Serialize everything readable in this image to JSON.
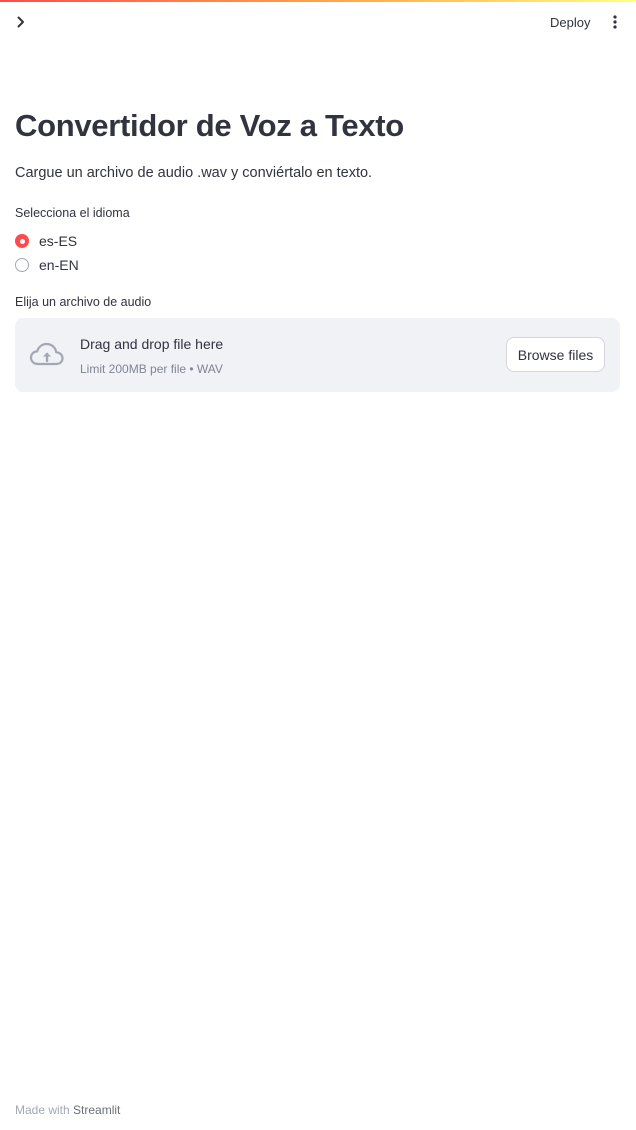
{
  "header": {
    "sidebar_toggle_icon": "chevron-right-icon",
    "deploy_label": "Deploy",
    "menu_icon": "vertical-dots-icon"
  },
  "main": {
    "title": "Convertidor de Voz a Texto",
    "subtitle": "Cargue un archivo de audio .wav y conviértalo en texto.",
    "language_radio": {
      "label": "Selecciona el idioma",
      "options": [
        {
          "label": "es-ES",
          "selected": true
        },
        {
          "label": "en-EN",
          "selected": false
        }
      ]
    },
    "file_uploader": {
      "label": "Elija un archivo de audio",
      "icon": "cloud-upload-icon",
      "drop_text": "Drag and drop file here",
      "limit_text": "Limit 200MB per file • WAV",
      "browse_label": "Browse files"
    }
  },
  "footer": {
    "made_with": "Made with",
    "brand": "Streamlit"
  },
  "colors": {
    "accent": "#ff4b4b",
    "text": "#31333f",
    "dropzone_bg": "#f0f2f6",
    "muted": "#808495"
  }
}
